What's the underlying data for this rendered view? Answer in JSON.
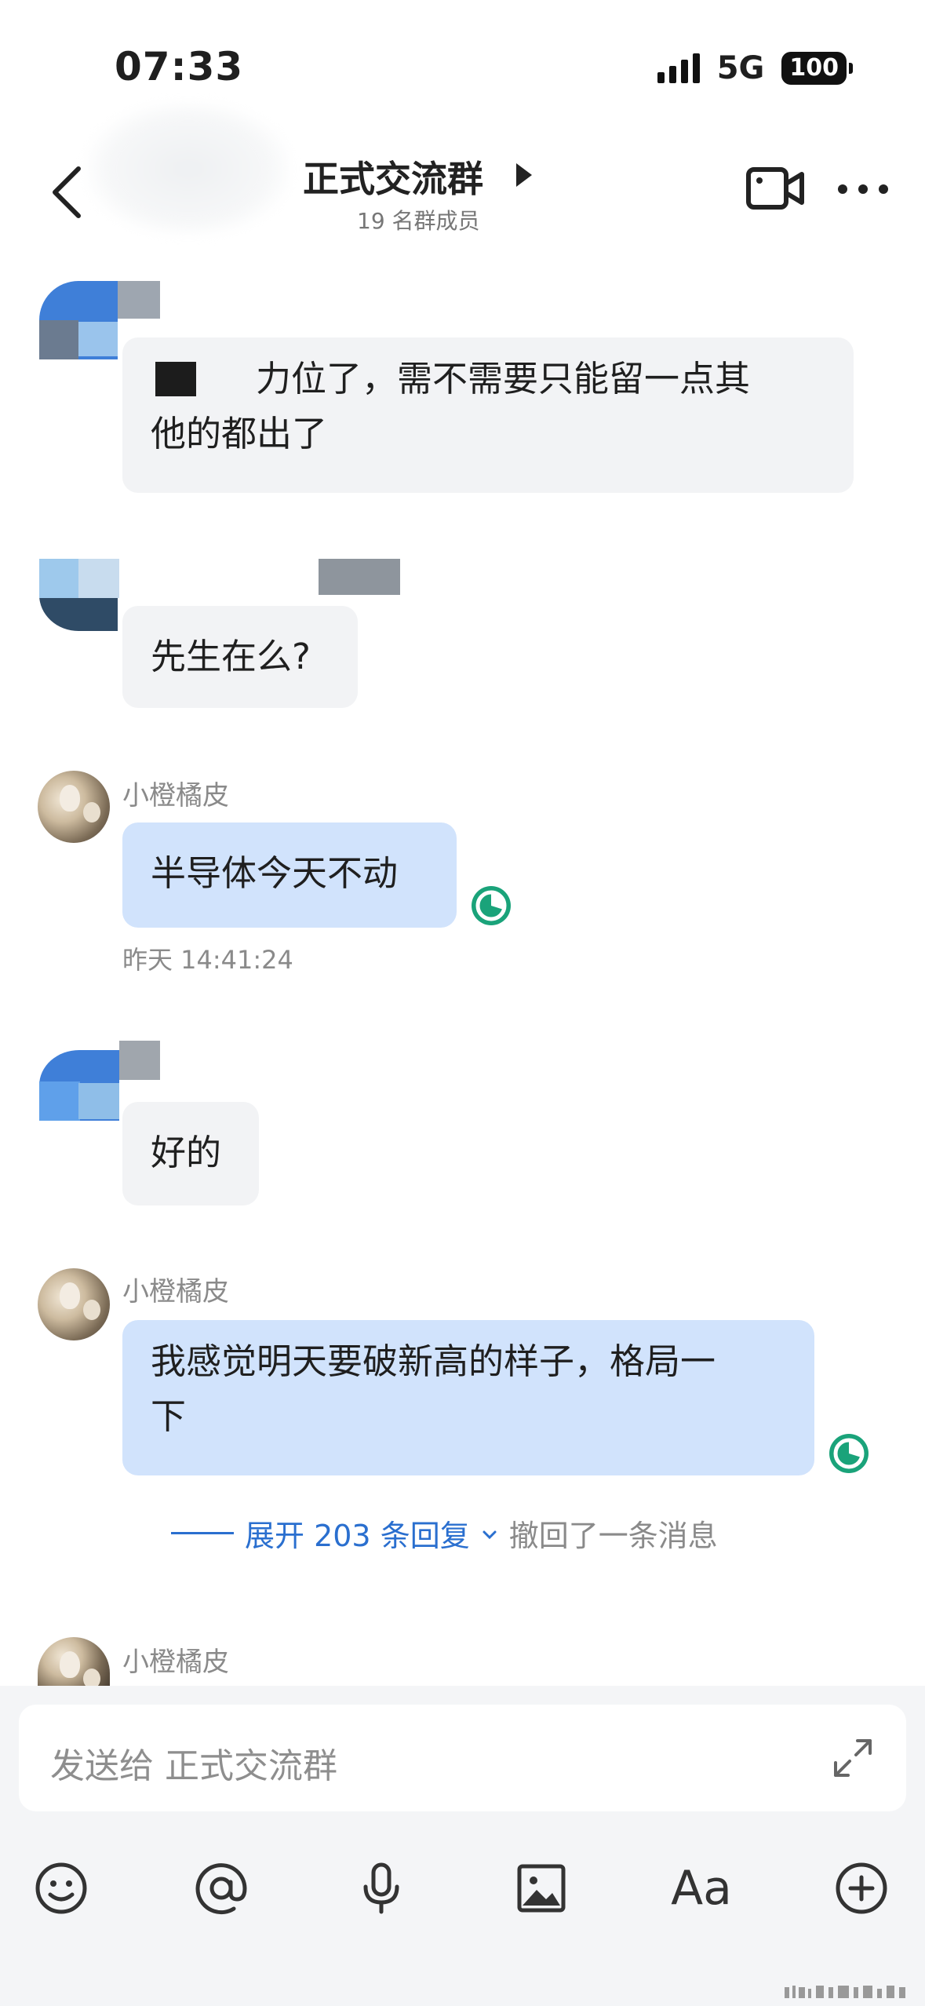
{
  "status_bar": {
    "time": "07:33",
    "network": "5G",
    "battery": "100"
  },
  "header": {
    "title": "正式交流群",
    "subtitle": "19 名群成员"
  },
  "messages": [
    {
      "type": "incoming-redacted",
      "text_line1": "力位了，需不需要只能留一点其",
      "text_line2": "他的都出了"
    },
    {
      "type": "incoming-redacted",
      "text": "先生在么?"
    },
    {
      "type": "mine",
      "sender": "小橙橘皮",
      "text": "半导体今天不动",
      "timestamp": "昨天 14:41:24"
    },
    {
      "type": "incoming-redacted",
      "text": "好的"
    },
    {
      "type": "mine",
      "sender": "小橙橘皮",
      "text_line1": "我感觉明天要破新高的样子，格局一",
      "text_line2": "下"
    },
    {
      "type": "mine-partial",
      "sender": "小橙橘皮"
    }
  ],
  "thread": {
    "expand_label": "展开 203 条回复",
    "recall_text": "撤回了一条消息"
  },
  "composer": {
    "placeholder": "发送给 正式交流群"
  },
  "toolbar": {
    "text_style_label": "Aa",
    "icons": [
      "emoji-icon",
      "mention-icon",
      "microphone-icon",
      "image-icon",
      "text-style-icon",
      "add-icon"
    ]
  },
  "colors": {
    "my_bubble": "#d1e3fc",
    "other_bubble": "#f2f3f5",
    "read_receipt": "#1aa37a",
    "link_blue": "#2a6fcf"
  }
}
